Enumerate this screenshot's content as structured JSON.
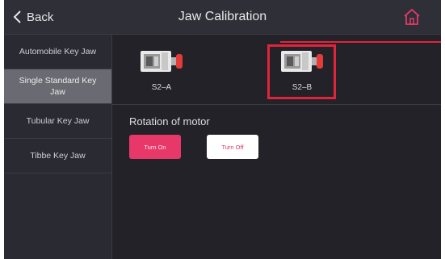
{
  "header": {
    "back_label": "Back",
    "title": "Jaw Calibration"
  },
  "sidebar": {
    "items": [
      {
        "label": "Automobile Key Jaw",
        "active": false
      },
      {
        "label": "Single Standard Key Jaw",
        "active": true
      },
      {
        "label": "Tubular Key Jaw",
        "active": false
      },
      {
        "label": "Tibbe Key Jaw",
        "active": false
      }
    ]
  },
  "jaws": {
    "items": [
      {
        "label": "S2–A",
        "selected": false
      },
      {
        "label": "S2–B",
        "selected": true
      }
    ]
  },
  "motor": {
    "label": "Rotation of motor",
    "on_label": "Turn On",
    "off_label": "Turn Off"
  },
  "colors": {
    "accent": "#e8386a",
    "highlight": "#e0243b",
    "background": "#222228"
  }
}
